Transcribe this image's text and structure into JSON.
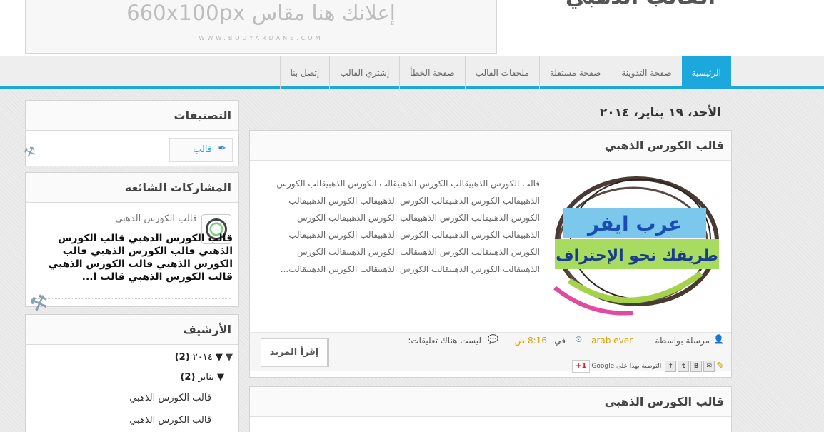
{
  "header": {
    "site_title": "القالب الذهبي",
    "ad_text": "إعلانك هنا مقاس 660x100px",
    "ad_url": "WWW.BOUYARDANE.COM"
  },
  "nav": {
    "items": [
      {
        "label": "الرئيسية",
        "active": true
      },
      {
        "label": "صفحة التدوينة",
        "active": false
      },
      {
        "label": "صفحة مستقلة",
        "active": false
      },
      {
        "label": "ملحقات القالب",
        "active": false
      },
      {
        "label": "صفحة الخطأ",
        "active": false
      },
      {
        "label": "إشتري القالب",
        "active": false
      },
      {
        "label": "إتصل بنا",
        "active": false
      }
    ]
  },
  "sidebar": {
    "categories": {
      "title": "التصنيفات",
      "items": [
        {
          "label": "قالب"
        }
      ]
    },
    "popular": {
      "title": "المشاركات الشائعة",
      "post_title": "قالب الكورس الذهبي",
      "excerpt": "قالب الكورس الذهبي قالب الكورس الذهبي قالب الكورس الذهبي قالب الكورس الذهبي قالب الكورس الذهبي قالب الكورس الذهبي قالب ا..."
    },
    "archive": {
      "title": "الأرشيف",
      "year": "▼ ٢٠١٤",
      "year_count": "(2)",
      "month": "▼ يناير",
      "month_count": "(2)",
      "posts": [
        "قالب الكورس الذهبي",
        "قالب الكورس الذهبي"
      ]
    }
  },
  "main": {
    "date_header": "الأحد، ١٩ يناير، ٢٠١٤",
    "posts": [
      {
        "title": "قالب الكورس الذهبي",
        "body": "قالب الكورس الذهبيقالب الكورس الذهبيقالب الكورس الذهبيقالب الكورس الذهبيقالب الكورس الذهبيقالب الكورس الذهبيقالب الكورس الذهبيقالب الكورس الذهبيقالب الكورس الذهبيقالب الكورس الذهبيقالب الكورس الذهبيقالب الكورس الذهبيقالب الكورس الذهبيقالب الكورس الذهبيقالب الكورس الذهبيقالب الكورس الذهبيقالب الكورس الذهبيقالب الكورس الذهبيقالب الكورس الذهبيقالب الكورس الذهبيقالب الكورس الذهبيقالب...",
        "image_text_top": "عرب ايفر",
        "image_text_bottom": "طريقك نحو الإحتراف",
        "posted_by_label": "مرسلة بواسطة",
        "author": "arab ever",
        "at_label": "في",
        "time": "8:16 ص",
        "comments": "ليست هناك تعليقات:",
        "read_more": "إقرأ المزيد",
        "share_label": "التوصية بهذا على Google",
        "gplus": "+1"
      },
      {
        "title": "قالب الكورس الذهبي"
      }
    ]
  },
  "colors": {
    "accent": "#1ca8dd",
    "author": "#d9a400"
  }
}
